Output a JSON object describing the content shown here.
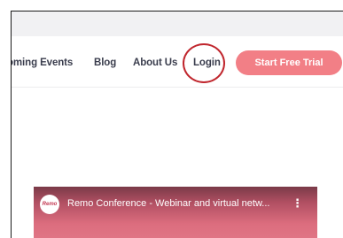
{
  "nav": {
    "upcoming_events": "oming Events",
    "blog": "Blog",
    "about_us": "About Us",
    "login": "Login",
    "cta_label": "Start Free Trial"
  },
  "video": {
    "logo_text": "Remo",
    "title": "Remo Conference - Webinar and virtual netw...",
    "menu_icon": "⋮"
  },
  "colors": {
    "accent": "#f27f86",
    "highlight_circle": "#c0262d",
    "nav_text": "#3a3d4d"
  }
}
